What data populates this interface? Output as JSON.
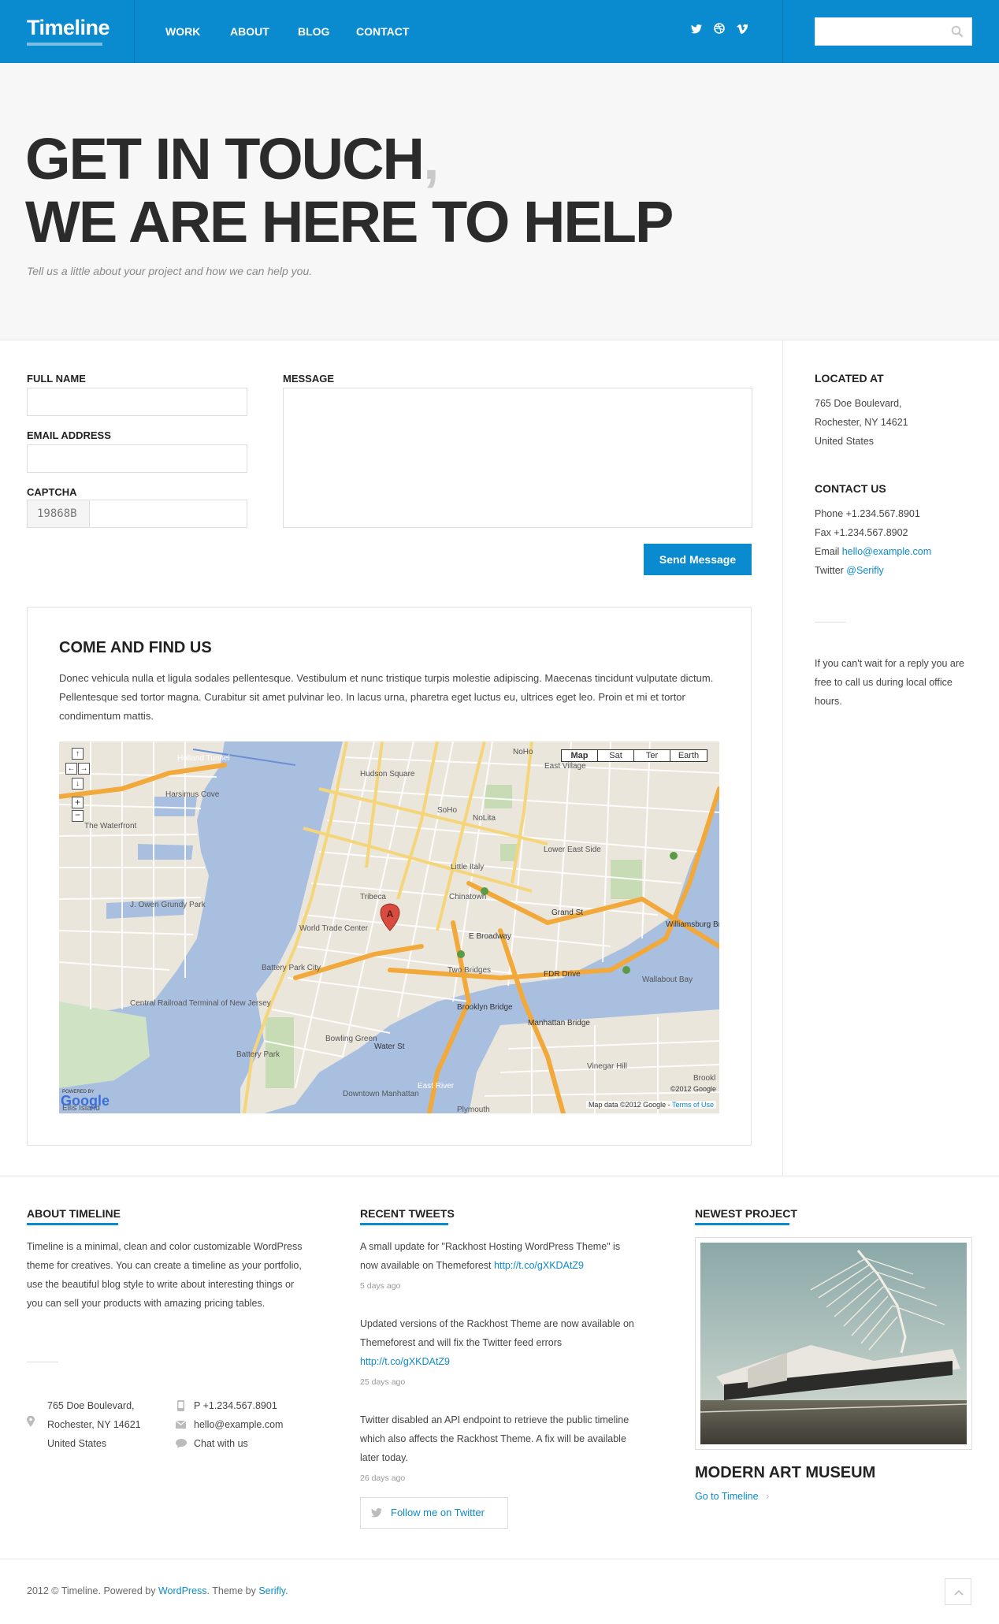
{
  "header": {
    "logo": "Timeline",
    "nav": [
      "WORK",
      "ABOUT",
      "BLOG",
      "CONTACT"
    ],
    "social_icons": [
      "twitter-icon",
      "dribbble-icon",
      "vimeo-icon"
    ],
    "search": {
      "placeholder": "",
      "icon": "search-icon"
    }
  },
  "hero": {
    "line1": "GET IN TOUCH",
    "comma": ",",
    "line2": "WE ARE HERE TO HELP",
    "subtitle": "Tell us a little about your project and how we can help you."
  },
  "form": {
    "full_name_label": "FULL NAME",
    "email_label": "EMAIL ADDRESS",
    "captcha_label": "CAPTCHA",
    "captcha_code": "19868B",
    "message_label": "MESSAGE",
    "full_name_value": "",
    "email_value": "",
    "captcha_value": "",
    "message_value": "",
    "send_label": "Send Message"
  },
  "find_us": {
    "title": "COME AND FIND US",
    "text": "Donec vehicula nulla et ligula sodales pellentesque. Vestibulum et nunc tristique turpis molestie adipiscing. Maecenas tincidunt vulputate dictum. Pellentesque sed tortor magna. Curabitur sit amet pulvinar leo. In lacus urna, pharetra eget luctus eu, ultrices eget leo. Proin et mi et tortor condimentum mattis.",
    "map": {
      "type_buttons": [
        "Map",
        "Sat",
        "Ter",
        "Earth"
      ],
      "selected_type": "Map",
      "marker": "A",
      "places": [
        "Holland Tunnel",
        "Hudson Square",
        "SoHo",
        "NoLita",
        "NoHo",
        "East Village",
        "Harsimus Cove",
        "The Waterfront",
        "Little Italy",
        "Lower East Side",
        "Tribeca",
        "Chinatown",
        "World Trade Center",
        "Battery Park City",
        "Two Bridges",
        "J. Owen Grundy Park",
        "Central Railroad Terminal of New Jersey",
        "Battery Park",
        "Bowling Green",
        "Downtown Manhattan",
        "Vinegar Hill",
        "Wallabout Bay",
        "Ellis Island",
        "FDR Drive",
        "E Broadway",
        "Grand St",
        "Williamsburg Br",
        "Brooklyn Bridge",
        "Manhattan Bridge",
        "East River",
        "Water St",
        "Plymouth",
        "Brookl"
      ],
      "attribution": "Map data ©2012 Google",
      "terms": "Terms of Use",
      "copyright": "©2012 Google",
      "powered": "POWERED BY",
      "google": "Google"
    }
  },
  "sidebar": {
    "located_title": "LOCATED AT",
    "address": [
      "765 Doe Boulevard,",
      "Rochester, NY 14621",
      "United States"
    ],
    "contact_title": "CONTACT US",
    "phone": "Phone +1.234.567.8901",
    "fax": "Fax +1.234.567.8902",
    "email_prefix": "Email ",
    "email": "hello@example.com",
    "twitter_prefix": "Twitter ",
    "twitter": "@Serifly",
    "note": "If you can't wait for a reply you are free to call us during local office hours."
  },
  "footer": {
    "about_title": "ABOUT TIMELINE",
    "about_text": "Timeline is a minimal, clean and color customizable WordPress theme for creatives. You can create a timeline as your portfolio, use the beautiful blog style to write about interesting things or you can sell your products with amazing pricing tables.",
    "address": [
      "765 Doe Boulevard,",
      "Rochester, NY 14621",
      "United States"
    ],
    "phone": "P +1.234.567.8901",
    "email": "hello@example.com",
    "chat": "Chat with us",
    "tweets_title": "RECENT TWEETS",
    "tweets": [
      {
        "text": "A small update for \"Rackhost Hosting WordPress Theme\" is now available on Themeforest ",
        "link": "http://t.co/gXKDAtZ9",
        "date": "5 days ago"
      },
      {
        "text": "Updated versions of the Rackhost Theme are now available on Themeforest and will fix the Twitter feed errors ",
        "link": "http://t.co/gXKDAtZ9",
        "date": "25 days ago"
      },
      {
        "text": "Twitter disabled an API endpoint to retrieve the public timeline which also affects the Rackhost Theme. A fix will be available later today.",
        "link": "",
        "date": "26 days ago"
      }
    ],
    "follow_label": "Follow me on Twitter",
    "project_title": "NEWEST PROJECT",
    "project_name": "MODERN ART MUSEUM",
    "project_link": "Go to Timeline"
  },
  "copyright": {
    "prefix": "2012 © Timeline. Powered by ",
    "wordpress": "WordPress",
    "middle": ". Theme by ",
    "serifly": "Serifly",
    "suffix": "."
  },
  "colors": {
    "accent": "#0a8bcf",
    "hero_bg": "#f7f7f7",
    "heading": "#2b2b2b",
    "comma": "#c9c9c9"
  }
}
